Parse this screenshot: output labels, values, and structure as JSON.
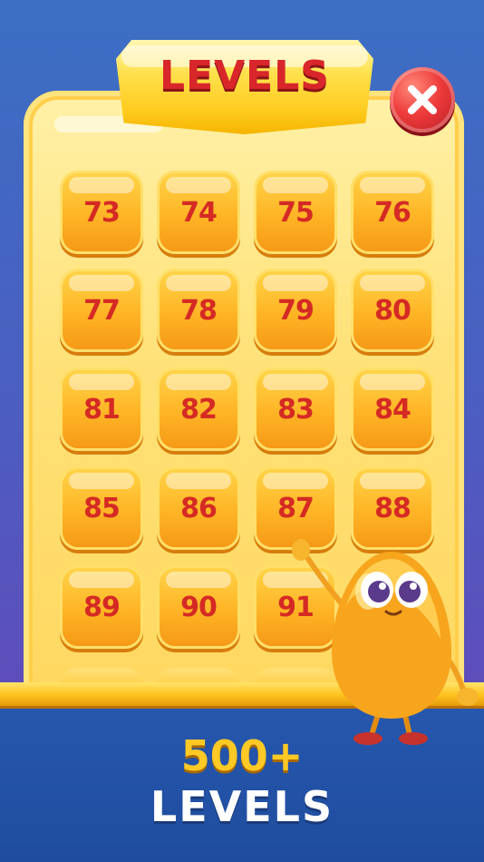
{
  "header": {
    "title": "LEVELS"
  },
  "close_button": {
    "icon": "close-icon"
  },
  "levels": [
    {
      "number": "73"
    },
    {
      "number": "74"
    },
    {
      "number": "75"
    },
    {
      "number": "76"
    },
    {
      "number": "77"
    },
    {
      "number": "78"
    },
    {
      "number": "79"
    },
    {
      "number": "80"
    },
    {
      "number": "81"
    },
    {
      "number": "82"
    },
    {
      "number": "83"
    },
    {
      "number": "84"
    },
    {
      "number": "85"
    },
    {
      "number": "86"
    },
    {
      "number": "87"
    },
    {
      "number": "88"
    },
    {
      "number": "89"
    },
    {
      "number": "90"
    },
    {
      "number": "91"
    }
  ],
  "promo": {
    "count": "500+",
    "label": "LEVELS"
  },
  "colors": {
    "background": "#3b6fc4",
    "panel": "#ffe27a",
    "tile": "#ffb425",
    "tile_number": "#d52a24",
    "title_text": "#d8262a",
    "close_button": "#ee3b3b",
    "promo_count": "#ffc925",
    "promo_label": "#ffffff",
    "bottom_band": "#2759b0"
  }
}
